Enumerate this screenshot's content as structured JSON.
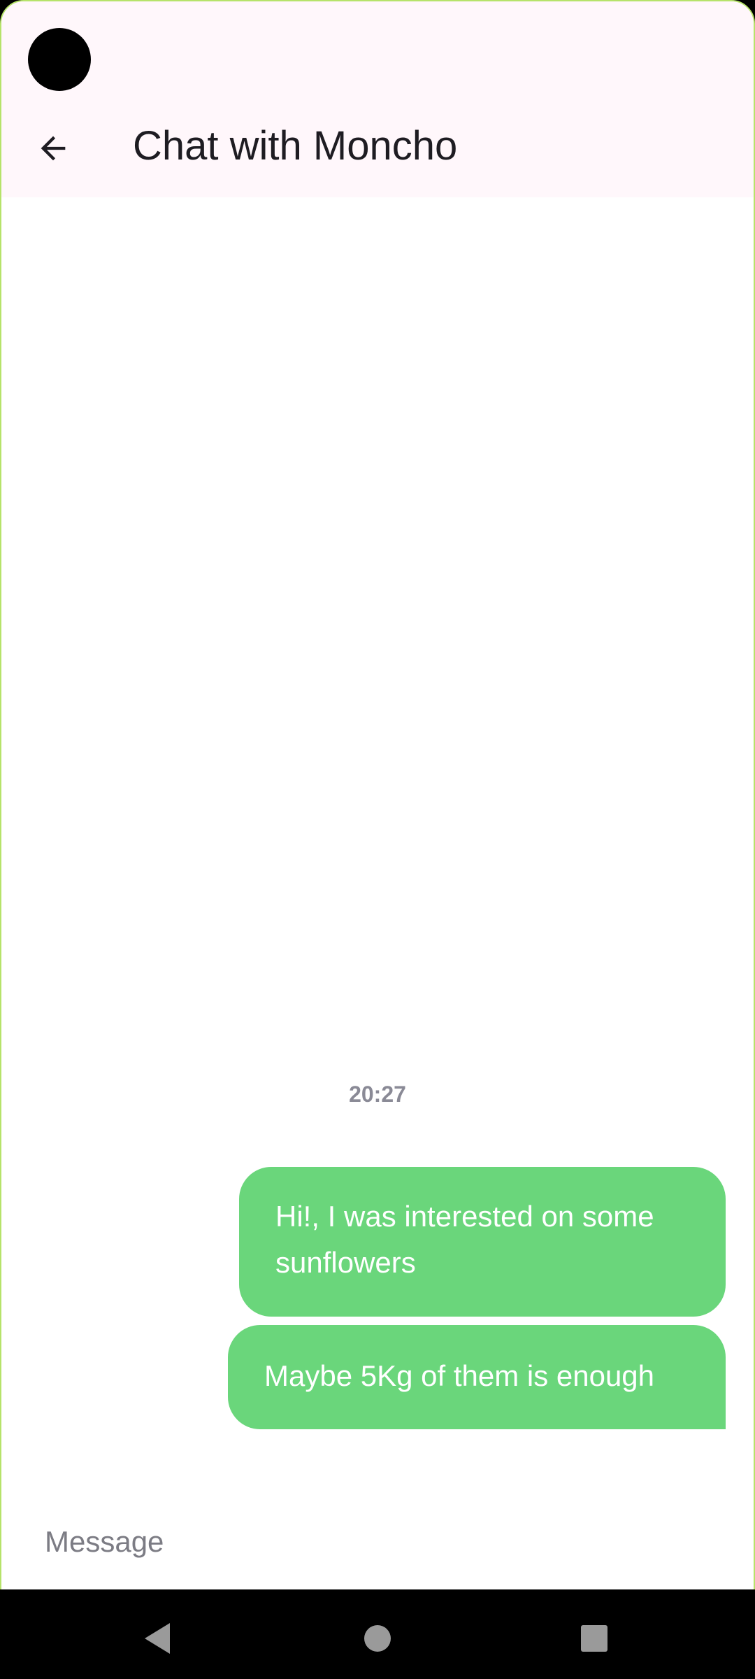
{
  "app_bar": {
    "title": "Chat with Moncho",
    "back_icon": "arrow-left-icon"
  },
  "chat": {
    "timestamp": "20:27",
    "messages": [
      {
        "text": "Hi!, I was interested on some sunflowers",
        "sender": "me"
      },
      {
        "text": "Maybe 5Kg of them is enough",
        "sender": "me"
      }
    ]
  },
  "composer": {
    "placeholder": "Message",
    "value": ""
  },
  "nav": {
    "back_icon": "triangle-back-icon",
    "home_icon": "circle-home-icon",
    "recents_icon": "square-recents-icon"
  },
  "colors": {
    "bubble": "#6ad67b",
    "app_bar_bg": "#fff7fb",
    "frame_border": "#b6e36a",
    "title_text": "#1e1c22",
    "timestamp_text": "#8a8a96"
  }
}
